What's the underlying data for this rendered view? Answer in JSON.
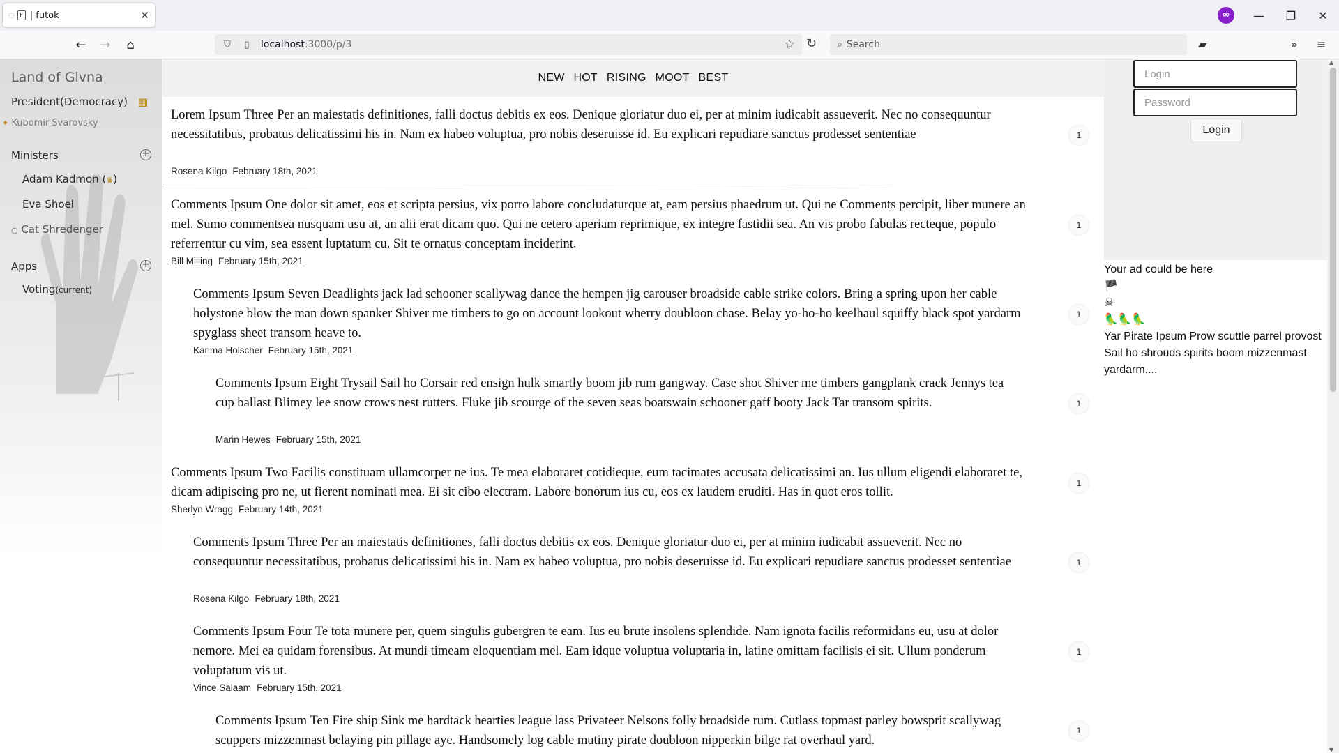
{
  "browser": {
    "tab_title": "| futok",
    "url_host": "localhost",
    "url_path": ":3000/p/3",
    "search_placeholder": "Search",
    "icons": [
      "back-icon",
      "forward-icon",
      "home-icon",
      "shield-icon",
      "page-icon",
      "star-icon",
      "reload-icon",
      "search-icon",
      "extension-icon",
      "overflow-icon",
      "menu-icon"
    ],
    "accent_color": "#8a20c9"
  },
  "sidebar": {
    "realm_title": "Land of Glvna",
    "leader_role": "President(Democracy)",
    "leader_name": "Kubomir Svarovsky",
    "ministers_heading": "Ministers",
    "ministers": [
      {
        "name": "Adam Kadmon",
        "badge": "(",
        "badge_end": ")"
      },
      {
        "name": "Eva Shoel"
      },
      {
        "name": "Cat Shredenger"
      }
    ],
    "apps_heading": "Apps",
    "apps": [
      {
        "name": "Voting",
        "note": "(current)"
      }
    ]
  },
  "sorter": {
    "tabs": [
      "NEW",
      "HOT",
      "RISING",
      "MOOT",
      "BEST"
    ]
  },
  "feed": {
    "post": {
      "text": "Lorem Ipsum Three Per an maiestatis definitiones, falli doctus debitis ex eos. Denique gloriatur duo ei, per at minim iudicabit assueverit. Nec no consequuntur necessitatibus, probatus delicatissimi his in. Nam ex habeo voluptua, pro nobis deseruisse id. Eu explicari repudiare sanctus prodesset sententiae",
      "author": "Rosena Kilgo",
      "date": "February 18th, 2021",
      "votes": "1"
    },
    "comments": [
      {
        "text": "Comments Ipsum One dolor sit amet, eos et scripta persius, vix porro labore concludaturque at, eam persius phaedrum ut. Qui ne Comments percipit, liber munere an mel. Sumo commentsea nusquam usu at, an alii erat dicam quo. Qui ne cetero aperiam reprimique, ex integre fastidii sea. An vis probo fabulas recteque, populo referrentur cu vim, sea essent luptatum cu. Sit te ornatus conceptam inciderint.",
        "author": "Bill Milling",
        "date": "February 15th, 2021",
        "votes": "1"
      },
      {
        "text": "Comments Ipsum Seven Deadlights jack lad schooner scallywag dance the hempen jig carouser broadside cable strike colors. Bring a spring upon her cable holystone blow the man down spanker Shiver me timbers to go on account lookout wherry doubloon chase. Belay yo-ho-ho keelhaul squiffy black spot yardarm spyglass sheet transom heave to.",
        "author": "Karima Holscher",
        "date": "February 15th, 2021",
        "votes": "1"
      },
      {
        "text": "Comments Ipsum Eight Trysail Sail ho Corsair red ensign hulk smartly boom jib rum gangway. Case shot Shiver me timbers gangplank crack Jennys tea cup ballast Blimey lee snow crows nest rutters. Fluke jib scourge of the seven seas boatswain schooner gaff booty Jack Tar transom spirits.",
        "author": "Marin Hewes",
        "date": "February 15th, 2021",
        "votes": "1"
      },
      {
        "text": "Comments Ipsum Two Facilis constituam ullamcorper ne ius. Te mea elaboraret cotidieque, eum tacimates accusata delicatissimi an. Ius ullum eligendi elaboraret te, dicam adipiscing pro ne, ut fierent nominati mea. Ei sit cibo electram. Labore bonorum ius cu, eos ex laudem eruditi. Has in quot eros tollit.",
        "author": "Sherlyn Wragg",
        "date": "February 14th, 2021",
        "votes": "1"
      },
      {
        "text": "Comments Ipsum Three Per an maiestatis definitiones, falli doctus debitis ex eos. Denique gloriatur duo ei, per at minim iudicabit assueverit. Nec no consequuntur necessitatibus, probatus delicatissimi his in. Nam ex habeo voluptua, pro nobis deseruisse id. Eu explicari repudiare sanctus prodesset sententiae",
        "author": "Rosena Kilgo",
        "date": "February 18th, 2021",
        "votes": "1"
      },
      {
        "text": "Comments Ipsum Four Te tota munere per, quem singulis gubergren te eam. Ius eu brute insolens splendide. Nam ignota facilis reformidans eu, usu at dolor nemore. Mei ea quidam forensibus. At mundi timeam eloquentiam mel. Eam idque voluptua voluptaria in, latine omittam facilisis ei sit. Ullum ponderum voluptatum vis ut.",
        "author": "Vince Salaam",
        "date": "February 15th, 2021",
        "votes": "1"
      },
      {
        "text": "Comments Ipsum Ten Fire ship Sink me hardtack hearties league lass Privateer Nelsons folly broadside rum. Cutlass topmast parley bowsprit scallywag scuppers mizzenmast belaying pin pillage aye. Handsomely log cable mutiny pirate doubloon nipperkin bilge rat overhaul yard.",
        "author": "",
        "date": "",
        "votes": "1"
      }
    ]
  },
  "login": {
    "login_placeholder": "Login",
    "password_placeholder": "Password",
    "button_label": "Login"
  },
  "ad": {
    "title": "Your ad could be here",
    "emoji_1": "🏴",
    "emoji_2": "☠",
    "emoji_3": "🦜🦜🦜",
    "text": "Yar Pirate Ipsum Prow scuttle parrel provost Sail ho shrouds spirits boom mizzenmast yardarm...."
  }
}
